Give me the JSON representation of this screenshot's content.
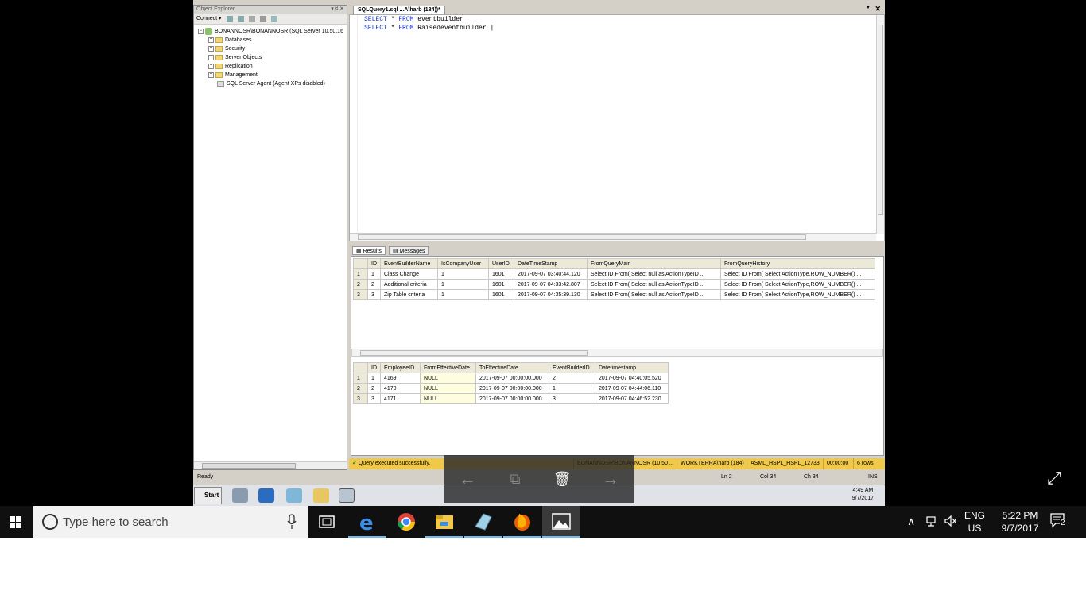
{
  "object_explorer": {
    "title": "Object Explorer",
    "title_controls": "▾ ♯ ✕",
    "connect_label": "Connect ▾",
    "server_node": "BONANNOSR\\BONANNOSR (SQL Server 10.50.16",
    "nodes": [
      "Databases",
      "Security",
      "Server Objects",
      "Replication",
      "Management"
    ],
    "agent_node": "SQL Server Agent (Agent XPs disabled)"
  },
  "editor": {
    "tab_title": "SQLQuery1.sql ...A\\harb (184))*",
    "dropdown": "▼",
    "close": "✕",
    "line1_kw1": "SELECT",
    "line1_mid": " * ",
    "line1_kw2": "FROM",
    "line1_rest": " eventbuilder",
    "line2_kw1": "SELECT",
    "line2_mid": " * ",
    "line2_kw2": "FROM",
    "line2_rest": " Raisedeventbuilder |"
  },
  "results_tabs": {
    "results": "Results",
    "messages": "Messages"
  },
  "grid1": {
    "columns": [
      "",
      "ID",
      "EventBuilderName",
      "IsCompanyUser",
      "UserID",
      "DateTimeStamp",
      "FromQueryMain",
      "FromQueryHistory"
    ],
    "rows": [
      [
        "1",
        "1",
        "Class Change",
        "1",
        "1601",
        "2017-09-07 03:40:44.120",
        "Select ID From(  Select null as ActionTypeID ...",
        "Select ID From(  Select ActionType,ROW_NUMBER() ..."
      ],
      [
        "2",
        "2",
        "Additional criteria",
        "1",
        "1601",
        "2017-09-07 04:33:42.807",
        "Select ID From(  Select null as ActionTypeID ...",
        "Select ID From(  Select ActionType,ROW_NUMBER() ..."
      ],
      [
        "3",
        "3",
        "Zip Table criteria",
        "1",
        "1601",
        "2017-09-07 04:35:39.130",
        "Select ID From(  Select null as ActionTypeID ...",
        "Select ID From(  Select ActionType,ROW_NUMBER() ..."
      ]
    ]
  },
  "grid2": {
    "columns": [
      "",
      "ID",
      "EmployeeID",
      "FromEffectiveDate",
      "ToEffectiveDate",
      "EventBuilderID",
      "Datetimestamp"
    ],
    "rows": [
      [
        "1",
        "1",
        "4169",
        "NULL",
        "2017-09-07 00:00:00.000",
        "2",
        "2017-09-07 04:40:05.520"
      ],
      [
        "2",
        "2",
        "4170",
        "NULL",
        "2017-09-07 00:00:00.000",
        "1",
        "2017-09-07 04:44:06.110"
      ],
      [
        "3",
        "3",
        "4171",
        "NULL",
        "2017-09-07 00:00:00.000",
        "3",
        "2017-09-07 04:46:52.230"
      ]
    ]
  },
  "query_status": {
    "message": "Query executed successfully.",
    "server": "BONANNOSR\\BONANNOSR (10.50 ...",
    "user": "WORKTERRA\\harb (184)",
    "database": "ASML_HSPL_HSPL_12733",
    "elapsed": "00:00:00",
    "rows": "6 rows"
  },
  "status_bar": {
    "ready": "Ready",
    "ln": "Ln 2",
    "col": "Col 34",
    "ch": "Ch 34",
    "ins": "INS"
  },
  "remote_taskbar": {
    "start": "Start",
    "time": "4:49 AM",
    "date": "9/7/2017"
  },
  "viewer": {
    "prev": "←",
    "slideshow": "⧉",
    "delete": "🗑",
    "next": "→",
    "expand": "⤢"
  },
  "taskbar": {
    "search_placeholder": "Type here to search",
    "lang_top": "ENG",
    "lang_bottom": "US",
    "time": "5:22 PM",
    "date": "9/7/2017",
    "notifications": "2"
  }
}
